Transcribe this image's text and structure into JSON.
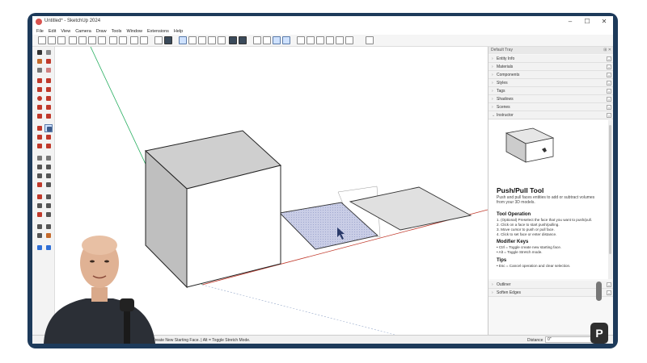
{
  "window": {
    "title": "Untitled* - SketchUp 2024",
    "controls": [
      "–",
      "☐",
      "✕"
    ]
  },
  "menu": [
    "File",
    "Edit",
    "View",
    "Camera",
    "Draw",
    "Tools",
    "Window",
    "Extensions",
    "Help"
  ],
  "tray": {
    "title": "Default Tray",
    "panels": [
      "Entity Info",
      "Materials",
      "Components",
      "Styles",
      "Tags",
      "Shadows",
      "Scenes"
    ],
    "active_panel": "Instructor",
    "bottom_panels": [
      "Outliner",
      "Soften Edges"
    ]
  },
  "instructor": {
    "tool_name": "Push/Pull Tool",
    "description": "Push and pull faces entities to add or subtract volumes from your 3D models.",
    "operation_title": "Tool Operation",
    "steps": [
      "1. (Optional) Preselect the face that you want to push/pull.",
      "2. Click on a face to start push/pulling.",
      "3. Move cursor to push or pull face.",
      "4. Click to set face or enter distance."
    ],
    "modifier_title": "Modifier Keys",
    "modifiers": [
      "• Ctrl = Toggle create new starting face.",
      "• Alt = Toggle Stretch mode."
    ],
    "tips_title": "Tips",
    "tips": [
      "• Esc = Cancel operation and clear selection."
    ]
  },
  "status": {
    "hint": "Create New Starting Face. | Alt = Toggle Stretch Mode.",
    "distance_label": "Distance",
    "distance_value": "0\""
  },
  "overlay": {
    "logo_letter": "P"
  },
  "colors": {
    "frame": "#1d3a5a",
    "selection": "#c9cde6",
    "axis_red": "#c0392b",
    "axis_green": "#27ae60",
    "axis_blue": "#2e6fd6"
  }
}
